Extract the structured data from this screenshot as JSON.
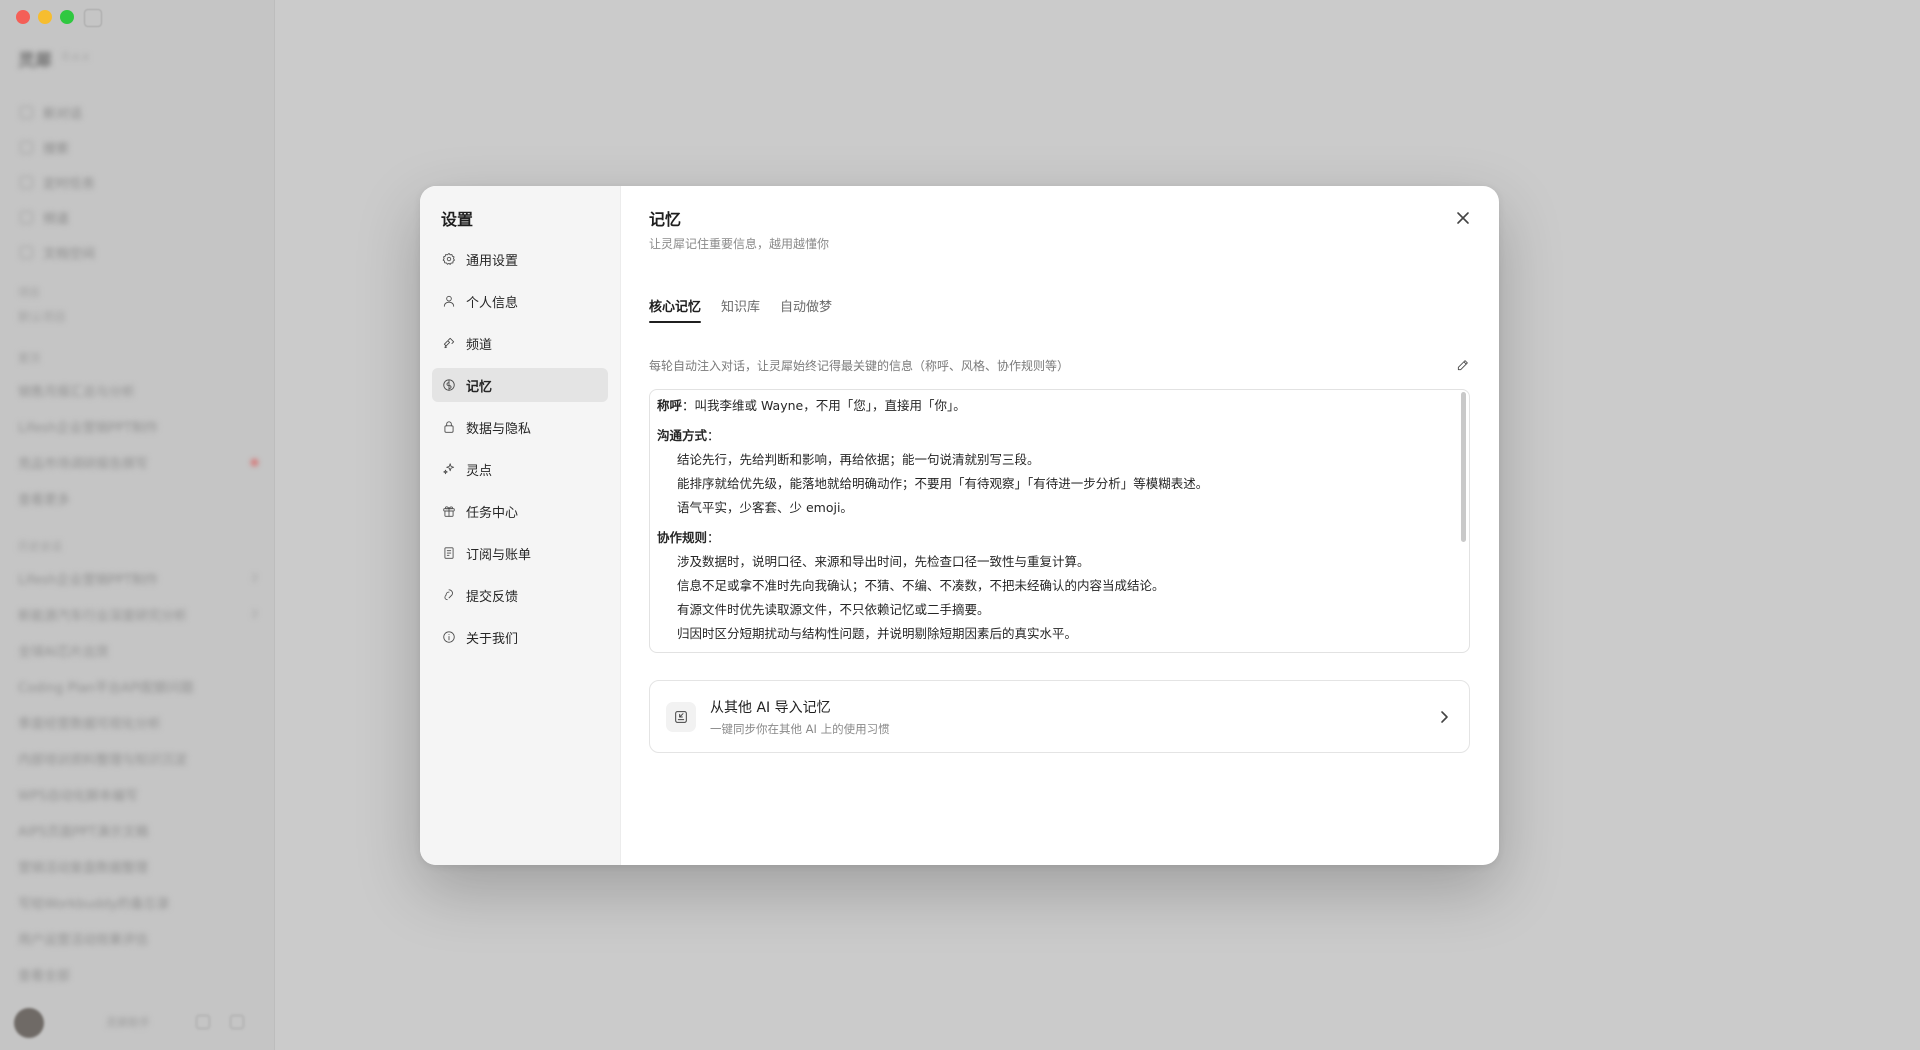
{
  "background_app": {
    "title": "灵犀",
    "version": "0.x.x",
    "nav": [
      "新对话",
      "搜索",
      "定时任务",
      "频道",
      "文档空间"
    ],
    "section_a": "项目",
    "section_a_item": "默认项目",
    "section_b": "置顶",
    "pinned": [
      "销售月报汇总与分析",
      "Lifesh企业营销PPT制作",
      "竞品市场调研报告撰写"
    ],
    "pinned_more": "查看更多",
    "section_c": "历史会话",
    "history": [
      "Lifesh企业营销PPT制作",
      "新能源汽车行业深度研究分析",
      "全球AI芯片出货",
      "Coding Plan平台API配额问题",
      "季度经营数据可视化分析",
      "内部培训资料整理与知识沉淀",
      "WPS自动化脚本编写",
      "AIPS页面PPT演示文稿",
      "营销活动复盘数据整理",
      "写给Workbuddy的备忘录",
      "用户运营活动效果评估"
    ],
    "history_more": "查看全部",
    "counts": [
      "2",
      "2"
    ],
    "bottom_label": "灵犀助手"
  },
  "settings": {
    "title": "设置",
    "nav": [
      {
        "label": "通用设置",
        "icon": "gear-icon"
      },
      {
        "label": "个人信息",
        "icon": "user-icon"
      },
      {
        "label": "频道",
        "icon": "channel-icon"
      },
      {
        "label": "记忆",
        "icon": "memory-icon",
        "active": true
      },
      {
        "label": "数据与隐私",
        "icon": "lock-icon"
      },
      {
        "label": "灵点",
        "icon": "sparkle-icon"
      },
      {
        "label": "任务中心",
        "icon": "gift-icon"
      },
      {
        "label": "订阅与账单",
        "icon": "receipt-icon"
      },
      {
        "label": "提交反馈",
        "icon": "feedback-icon"
      },
      {
        "label": "关于我们",
        "icon": "info-icon"
      }
    ]
  },
  "memory": {
    "title": "记忆",
    "subtitle": "让灵犀记住重要信息，越用越懂你",
    "tabs": [
      "核心记忆",
      "知识库",
      "自动做梦"
    ],
    "description": "每轮自动注入对话，让灵犀始终记得最关键的信息（称呼、风格、协作规则等）",
    "address_label": "称呼",
    "address_text": "：叫我李维或 Wayne，不用「您」，直接用「你」。",
    "comm_title": "沟通方式",
    "comm_suffix": "：",
    "comm_items": [
      "结论先行，先给判断和影响，再给依据；能一句说清就别写三段。",
      "能排序就给优先级，能落地就给明确动作；不要用「有待观察」「有待进一步分析」等模糊表述。",
      "语气平实，少客套、少 emoji。"
    ],
    "collab_title": "协作规则",
    "collab_suffix": "：",
    "collab_items": [
      "涉及数据时，说明口径、来源和导出时间，先检查口径一致性与重复计算。",
      "信息不足或拿不准时先向我确认；不猜、不编、不凑数，不把未经确认的内容当成结论。",
      "有源文件时优先读取源文件，不只依赖记忆或二手摘要。",
      "归因时区分短期扰动与结构性问题，并说明剔除短期因素后的真实水平。"
    ],
    "import_title": "从其他 AI 导入记忆",
    "import_subtitle": "一键同步你在其他 AI 上的使用习惯"
  }
}
